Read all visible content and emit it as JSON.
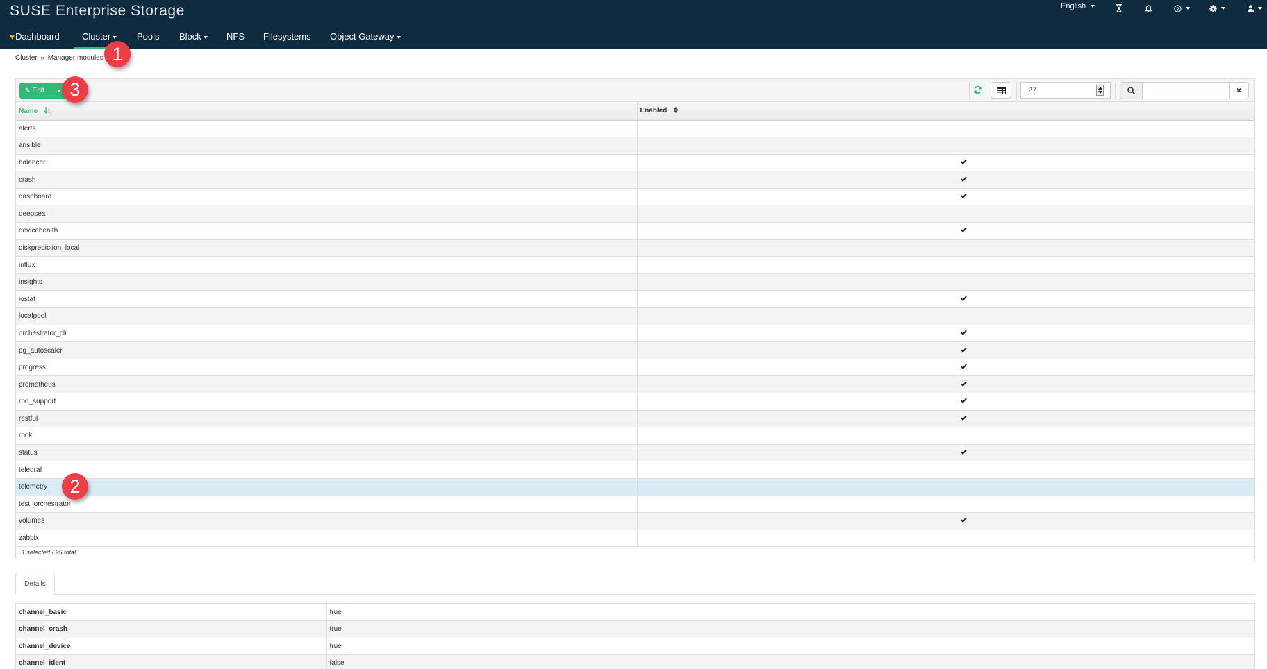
{
  "app": {
    "title": "SUSE Enterprise Storage"
  },
  "nav": {
    "items": [
      {
        "label": "Dashboard",
        "icon": "heart-pulse-icon",
        "has_caret": false,
        "active": false
      },
      {
        "label": "Cluster",
        "has_caret": true,
        "active": true
      },
      {
        "label": "Pools",
        "has_caret": false,
        "active": false
      },
      {
        "label": "Block",
        "has_caret": true,
        "active": false
      },
      {
        "label": "NFS",
        "has_caret": false,
        "active": false
      },
      {
        "label": "Filesystems",
        "has_caret": false,
        "active": false
      },
      {
        "label": "Object Gateway",
        "has_caret": true,
        "active": false
      }
    ],
    "utility": {
      "language": "English",
      "icons": [
        "hourglass-icon",
        "bell-icon",
        "help-icon",
        "gear-icon",
        "user-icon"
      ]
    }
  },
  "breadcrumb": {
    "parent": "Cluster",
    "separator": "»",
    "current": "Manager modules"
  },
  "toolbar": {
    "edit_label": "Edit",
    "page_size": "27",
    "search_placeholder": "",
    "search_value": "",
    "clear_label": "×"
  },
  "table": {
    "columns": [
      {
        "label": "Name",
        "sorted": "ascending"
      },
      {
        "label": "Enabled",
        "sorted": "none"
      }
    ],
    "rows": [
      {
        "name": "alerts",
        "enabled": false
      },
      {
        "name": "ansible",
        "enabled": false
      },
      {
        "name": "balancer",
        "enabled": true
      },
      {
        "name": "crash",
        "enabled": true
      },
      {
        "name": "dashboard",
        "enabled": true
      },
      {
        "name": "deepsea",
        "enabled": false
      },
      {
        "name": "devicehealth",
        "enabled": true
      },
      {
        "name": "diskprediction_local",
        "enabled": false
      },
      {
        "name": "influx",
        "enabled": false
      },
      {
        "name": "insights",
        "enabled": false
      },
      {
        "name": "iostat",
        "enabled": true
      },
      {
        "name": "localpool",
        "enabled": false
      },
      {
        "name": "orchestrator_cli",
        "enabled": true
      },
      {
        "name": "pg_autoscaler",
        "enabled": true
      },
      {
        "name": "progress",
        "enabled": true
      },
      {
        "name": "prometheus",
        "enabled": true
      },
      {
        "name": "rbd_support",
        "enabled": true
      },
      {
        "name": "restful",
        "enabled": true
      },
      {
        "name": "rook",
        "enabled": false
      },
      {
        "name": "status",
        "enabled": true
      },
      {
        "name": "telegraf",
        "enabled": false
      },
      {
        "name": "telemetry",
        "enabled": false,
        "selected": true
      },
      {
        "name": "test_orchestrator",
        "enabled": false
      },
      {
        "name": "volumes",
        "enabled": true
      },
      {
        "name": "zabbix",
        "enabled": false
      }
    ],
    "footer": "1 selected / 25 total"
  },
  "details": {
    "tab_label": "Details",
    "rows": [
      {
        "key": "channel_basic",
        "value": "true"
      },
      {
        "key": "channel_crash",
        "value": "true"
      },
      {
        "key": "channel_device",
        "value": "true"
      },
      {
        "key": "channel_ident",
        "value": "false"
      }
    ]
  },
  "annotations": [
    "1",
    "2",
    "3"
  ],
  "colors": {
    "navbar": "#0e2b40",
    "accent": "#30ba78",
    "selected_row": "#d9ebf5",
    "marker": "#ee3e45"
  }
}
